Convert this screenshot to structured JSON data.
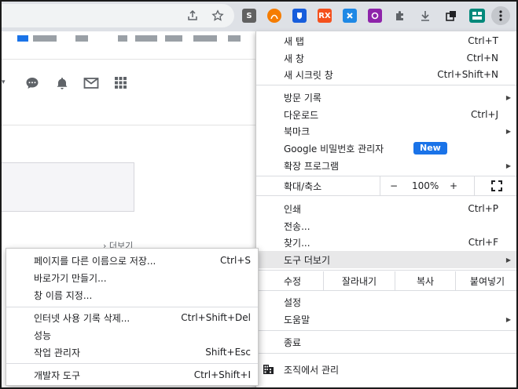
{
  "colors": {
    "toolbar": "#dee1e6",
    "badge": "#1a73e8",
    "highlight": "#e8e8e9"
  },
  "toolbar": {
    "icons": [
      "share-icon",
      "star-icon",
      "extensions-puzzle-icon",
      "download-icon",
      "tab-search-icon",
      "profile-icon",
      "kebab-menu-icon"
    ],
    "extensions": [
      {
        "name": "s-extension-icon",
        "label": "S",
        "color": "#616161"
      },
      {
        "name": "orange-extension-icon",
        "label": "",
        "color": "#f57c00"
      },
      {
        "name": "bitwarden-extension-icon",
        "label": "",
        "color": "#175ddc"
      },
      {
        "name": "rx-extension-icon",
        "label": "RX",
        "color": "#f4511e"
      },
      {
        "name": "x-extension-icon",
        "label": "",
        "color": "#1e88e5"
      },
      {
        "name": "purple-extension-icon",
        "label": "",
        "color": "#8e24aa"
      },
      {
        "name": "teal-extension-icon",
        "label": "",
        "color": "#00897b"
      }
    ]
  },
  "page": {
    "more_link": "더보기"
  },
  "menu": {
    "new_tab": {
      "label": "새 탭",
      "shortcut": "Ctrl+T"
    },
    "new_window": {
      "label": "새 창",
      "shortcut": "Ctrl+N"
    },
    "new_incognito": {
      "label": "새 시크릿 창",
      "shortcut": "Ctrl+Shift+N"
    },
    "history": {
      "label": "방문 기록"
    },
    "downloads": {
      "label": "다운로드",
      "shortcut": "Ctrl+J"
    },
    "bookmarks": {
      "label": "북마크"
    },
    "password_manager": {
      "label": "Google 비밀번호 관리자",
      "badge": "New"
    },
    "extensions": {
      "label": "확장 프로그램"
    },
    "zoom": {
      "label": "확대/축소",
      "minus": "−",
      "value": "100%",
      "plus": "+"
    },
    "print": {
      "label": "인쇄",
      "shortcut": "Ctrl+P"
    },
    "cast": {
      "label": "전송..."
    },
    "find": {
      "label": "찾기...",
      "shortcut": "Ctrl+F"
    },
    "more_tools": {
      "label": "도구 더보기"
    },
    "edit": {
      "label": "수정",
      "cut": "잘라내기",
      "copy": "복사",
      "paste": "붙여넣기"
    },
    "settings": {
      "label": "설정"
    },
    "help": {
      "label": "도움말"
    },
    "exit": {
      "label": "종료"
    },
    "managed": {
      "label": "조직에서 관리"
    }
  },
  "submenu": {
    "save_page": {
      "label": "페이지를 다른 이름으로 저장...",
      "shortcut": "Ctrl+S"
    },
    "create_shortcut": {
      "label": "바로가기 만들기..."
    },
    "name_window": {
      "label": "창 이름 지정..."
    },
    "clear_data": {
      "label": "인터넷 사용 기록 삭제...",
      "shortcut": "Ctrl+Shift+Del"
    },
    "performance": {
      "label": "성능"
    },
    "task_manager": {
      "label": "작업 관리자",
      "shortcut": "Shift+Esc"
    },
    "dev_tools": {
      "label": "개발자 도구",
      "shortcut": "Ctrl+Shift+I"
    }
  }
}
